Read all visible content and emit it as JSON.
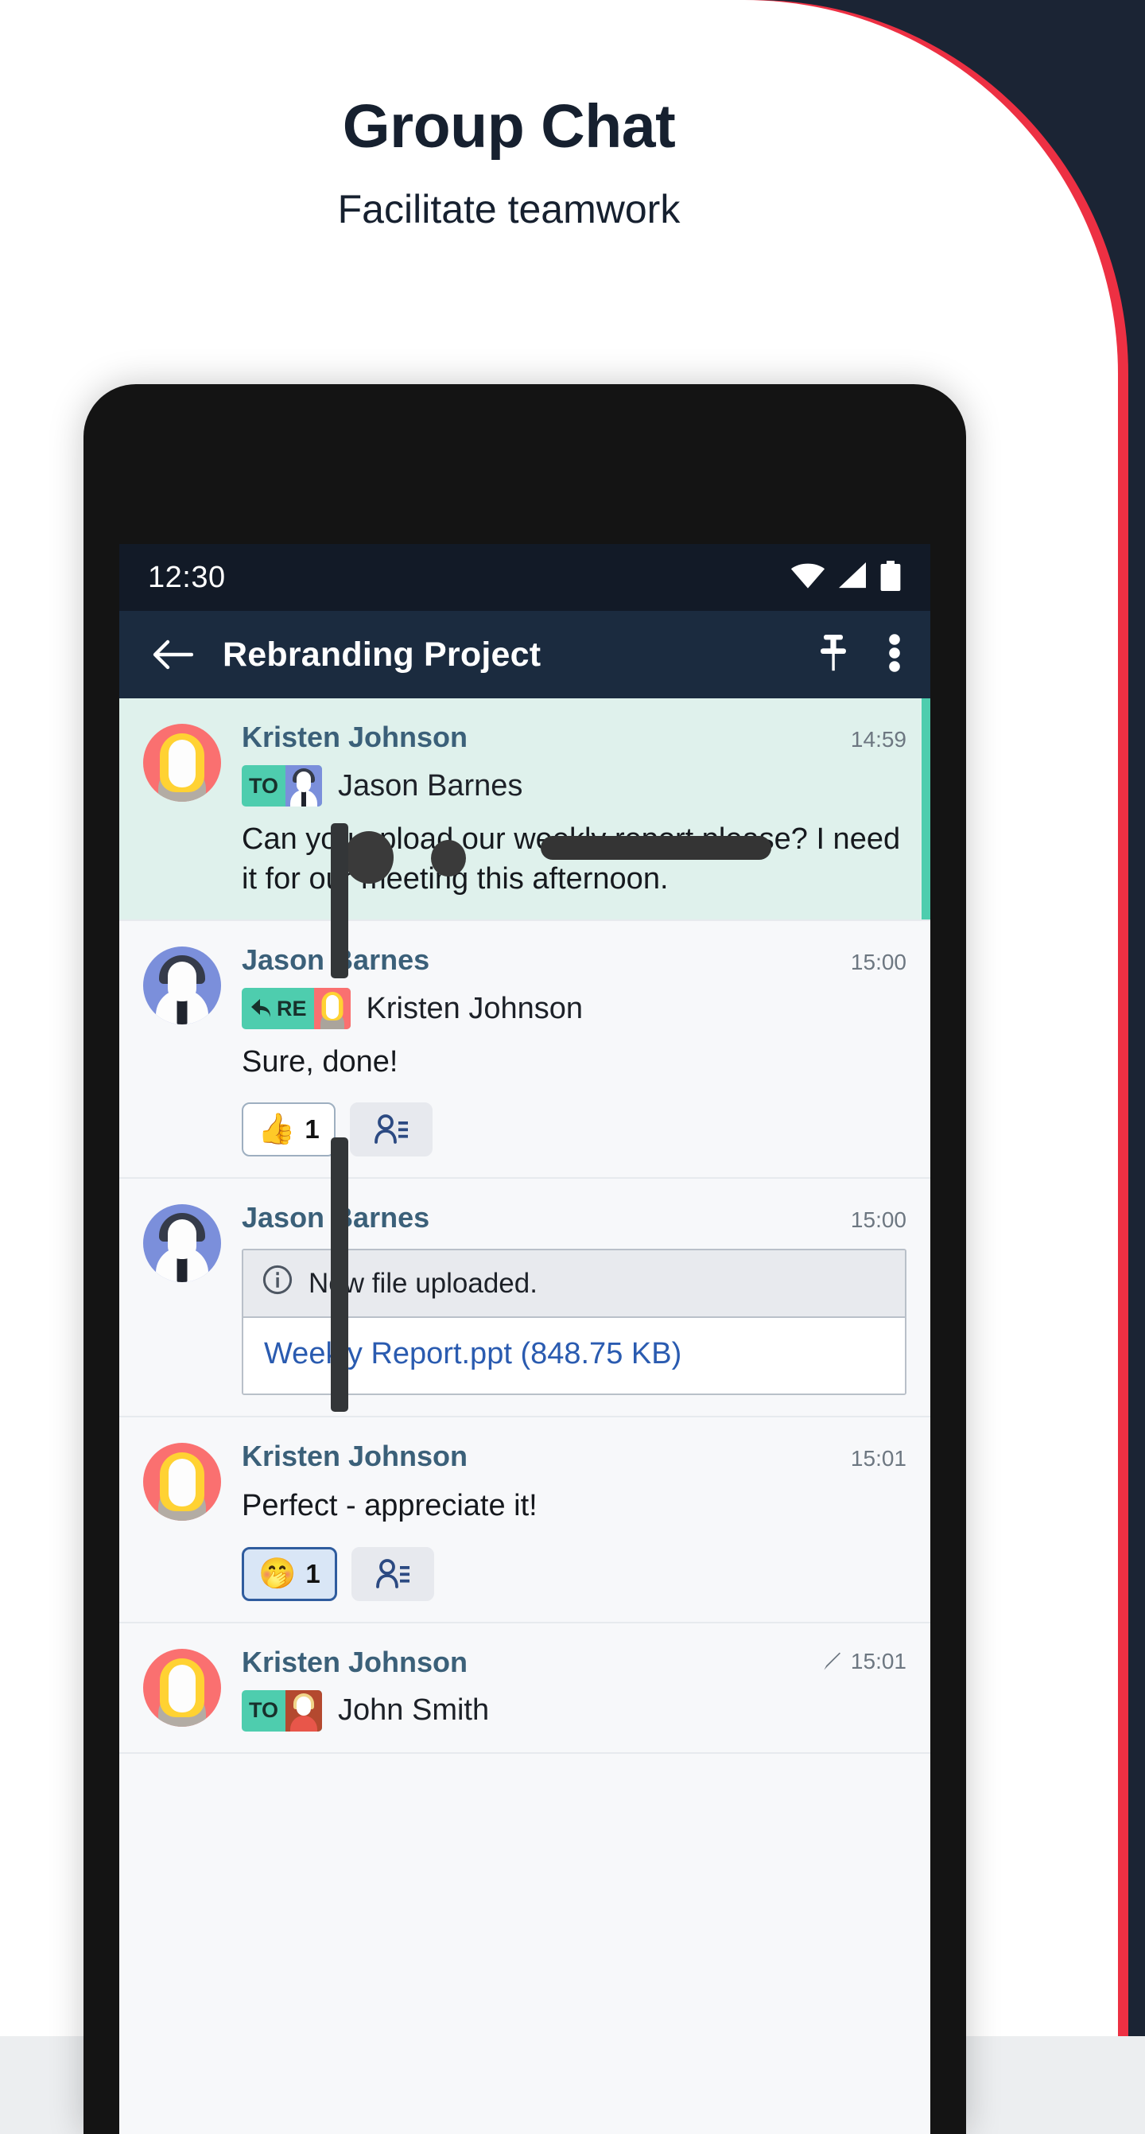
{
  "promo": {
    "headline": "Group Chat",
    "subhead": "Facilitate teamwork"
  },
  "device": {
    "statusbar": {
      "time": "12:30",
      "icons": [
        "wifi-icon",
        "cellular-signal-icon",
        "battery-icon"
      ]
    },
    "appbar": {
      "back_icon": "arrow-left-icon",
      "title": "Rebranding Project",
      "pin_icon": "pin-icon",
      "overflow_icon": "more-vertical-icon"
    }
  },
  "labels": {
    "to": "TO",
    "re": "RE"
  },
  "messages": [
    {
      "sender": "Kristen Johnson",
      "avatar": "kristen",
      "time": "14:59",
      "highlighted": true,
      "edited": false,
      "tag": "TO",
      "tag_kind": "to",
      "tag_avatar": "jason",
      "recipient": "Jason Barnes",
      "text": "Can you upload our weekly report,please? I need it for our meeting this afternoon.",
      "reactions": []
    },
    {
      "sender": "Jason Barnes",
      "avatar": "jason",
      "time": "15:00",
      "highlighted": false,
      "edited": false,
      "tag": "RE",
      "tag_kind": "re",
      "tag_avatar": "kristen",
      "recipient": "Kristen Johnson",
      "text": "Sure, done!",
      "reactions": [
        {
          "emoji": "👍",
          "count": "1",
          "selected": false
        },
        {
          "emoji": "people-list-icon",
          "count": "",
          "selected": false
        }
      ]
    },
    {
      "sender": "Jason Barnes",
      "avatar": "jason",
      "time": "15:00",
      "highlighted": false,
      "edited": false,
      "file": {
        "notice_icon": "info-icon",
        "notice": "New file uploaded.",
        "link": "Weekly Report.ppt (848.75 KB)"
      },
      "reactions": []
    },
    {
      "sender": "Kristen Johnson",
      "avatar": "kristen",
      "time": "15:01",
      "highlighted": false,
      "edited": false,
      "text": "Perfect - appreciate it!",
      "reactions": [
        {
          "emoji": "🤭",
          "count": "1",
          "selected": true
        },
        {
          "emoji": "people-list-icon",
          "count": "",
          "selected": false
        }
      ]
    },
    {
      "sender": "Kristen Johnson",
      "avatar": "kristen",
      "time": "15:01",
      "highlighted": false,
      "edited": true,
      "edit_icon": "pencil-icon",
      "tag": "TO",
      "tag_kind": "to",
      "tag_avatar": "smith",
      "recipient": "John Smith",
      "text": "",
      "reactions": []
    }
  ],
  "colors": {
    "brand_red": "#ed3043",
    "dark_navy": "#1b2434",
    "appbar": "#1b2b3f",
    "statusbar": "#121a27",
    "accent_teal": "#4ecdae",
    "highlight_bg": "#dff1ec",
    "sender_blue": "#3b6079",
    "link_blue": "#2a5bb0"
  }
}
